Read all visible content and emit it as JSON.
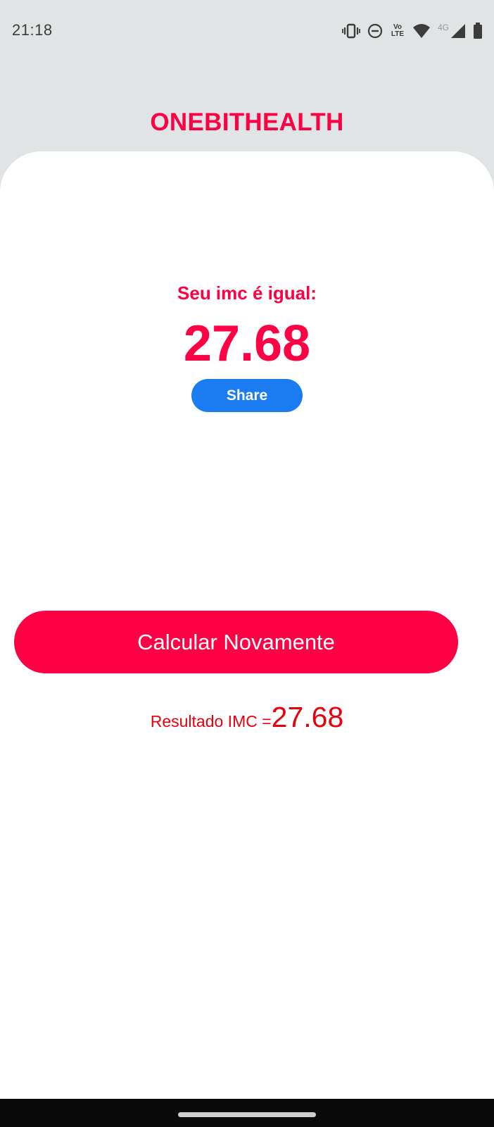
{
  "status_bar": {
    "time": "21:18",
    "icons": [
      "vibrate-icon",
      "dnd-icon",
      "volte-icon",
      "wifi-icon",
      "signal-4g-icon",
      "battery-icon"
    ],
    "lte_top": "Vo",
    "lte_bottom": "LTE",
    "network_label": "4G"
  },
  "header": {
    "title": "ONEBITHEALTH"
  },
  "result": {
    "label": "Seu imc é igual:",
    "value": "27.68",
    "share_label": "Share"
  },
  "actions": {
    "recalculate_label": "Calcular Novamente"
  },
  "imc_summary": {
    "prefix": "Resultado IMC =",
    "value": "27.68"
  },
  "colors": {
    "accent": "#ff0044",
    "share": "#1b7cf2",
    "summary_text": "#e8000c",
    "background": "#e0e4e5"
  }
}
